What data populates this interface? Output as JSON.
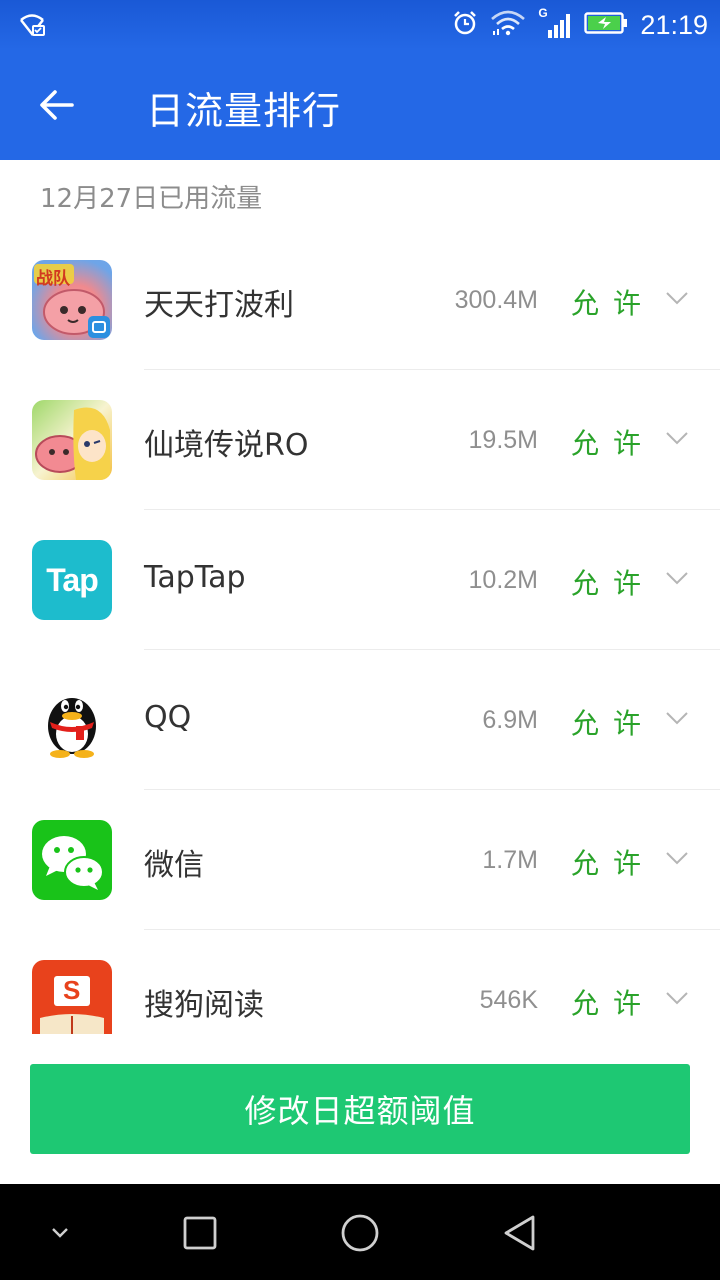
{
  "status_bar": {
    "time": "21:19",
    "network_type": "G"
  },
  "header": {
    "title": "日流量排行"
  },
  "section": {
    "title": "12月27日已用流量"
  },
  "apps": [
    {
      "name": "天天打波利",
      "usage": "300.4M",
      "permission": "允许",
      "icon": "tiantian-dabolie-app-icon",
      "icon_text": "战队"
    },
    {
      "name": "仙境传说RO",
      "usage": "19.5M",
      "permission": "允许",
      "icon": "ragnarok-app-icon"
    },
    {
      "name": "TapTap",
      "usage": "10.2M",
      "permission": "允许",
      "icon": "taptap-app-icon",
      "icon_text": "Tap"
    },
    {
      "name": "QQ",
      "usage": "6.9M",
      "permission": "允许",
      "icon": "qq-penguin-app-icon"
    },
    {
      "name": "微信",
      "usage": "1.7M",
      "permission": "允许",
      "icon": "wechat-app-icon"
    },
    {
      "name": "搜狗阅读",
      "usage": "546K",
      "permission": "允许",
      "icon": "sogou-reader-app-icon",
      "icon_text": "S"
    }
  ],
  "action_button": {
    "label": "修改日超额阈值"
  },
  "colors": {
    "accent": "#2468e6",
    "permit_green": "#2aa32a",
    "button_green": "#1ec873"
  }
}
